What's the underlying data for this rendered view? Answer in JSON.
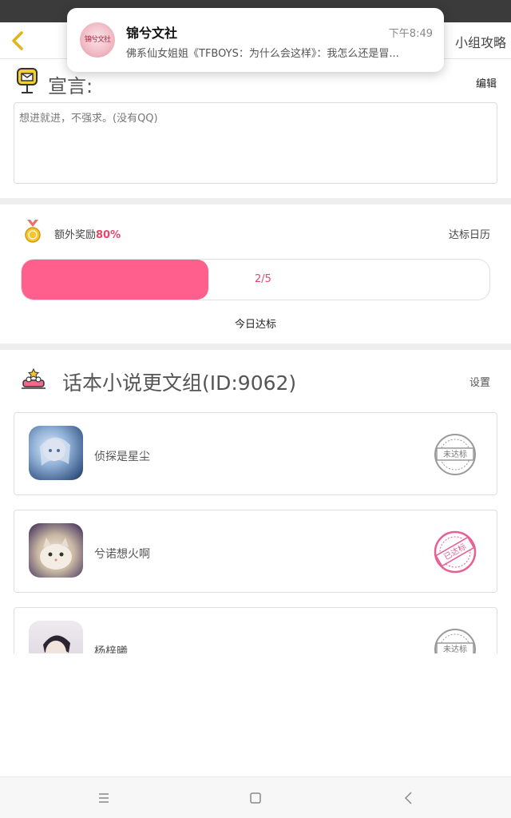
{
  "notification": {
    "app_name": "锦兮文社",
    "avatar_text": "锦兮文社",
    "time": "下午8:49",
    "body": "佛系仙女姐姐《TFBOYS：为什么会这样》：我怎么还是冒..."
  },
  "appbar": {
    "right_link": "小组攻略"
  },
  "declaration": {
    "title": "宣言:",
    "edit_label": "编辑",
    "text": "想进就进，不强求。(没有QQ)"
  },
  "reward": {
    "label": "额外奖励",
    "percent": "80%",
    "calendar_label": "达标日历",
    "progress_text": "2/5",
    "progress_value": 0.4,
    "today_label": "今日达标"
  },
  "group": {
    "title": "话本小说更文组(ID:9062)",
    "settings_label": "设置",
    "members": [
      {
        "name": "侦探是星尘",
        "status": "未达标"
      },
      {
        "name": "兮诺想火啊",
        "status": "已达标"
      },
      {
        "name": "杨梓曦",
        "status": "未达标"
      }
    ]
  },
  "colors": {
    "accent": "#ff5f8c",
    "accent_text": "#e5476b",
    "status_bar": "#3b3b3b",
    "gap": "#eeeeee"
  }
}
